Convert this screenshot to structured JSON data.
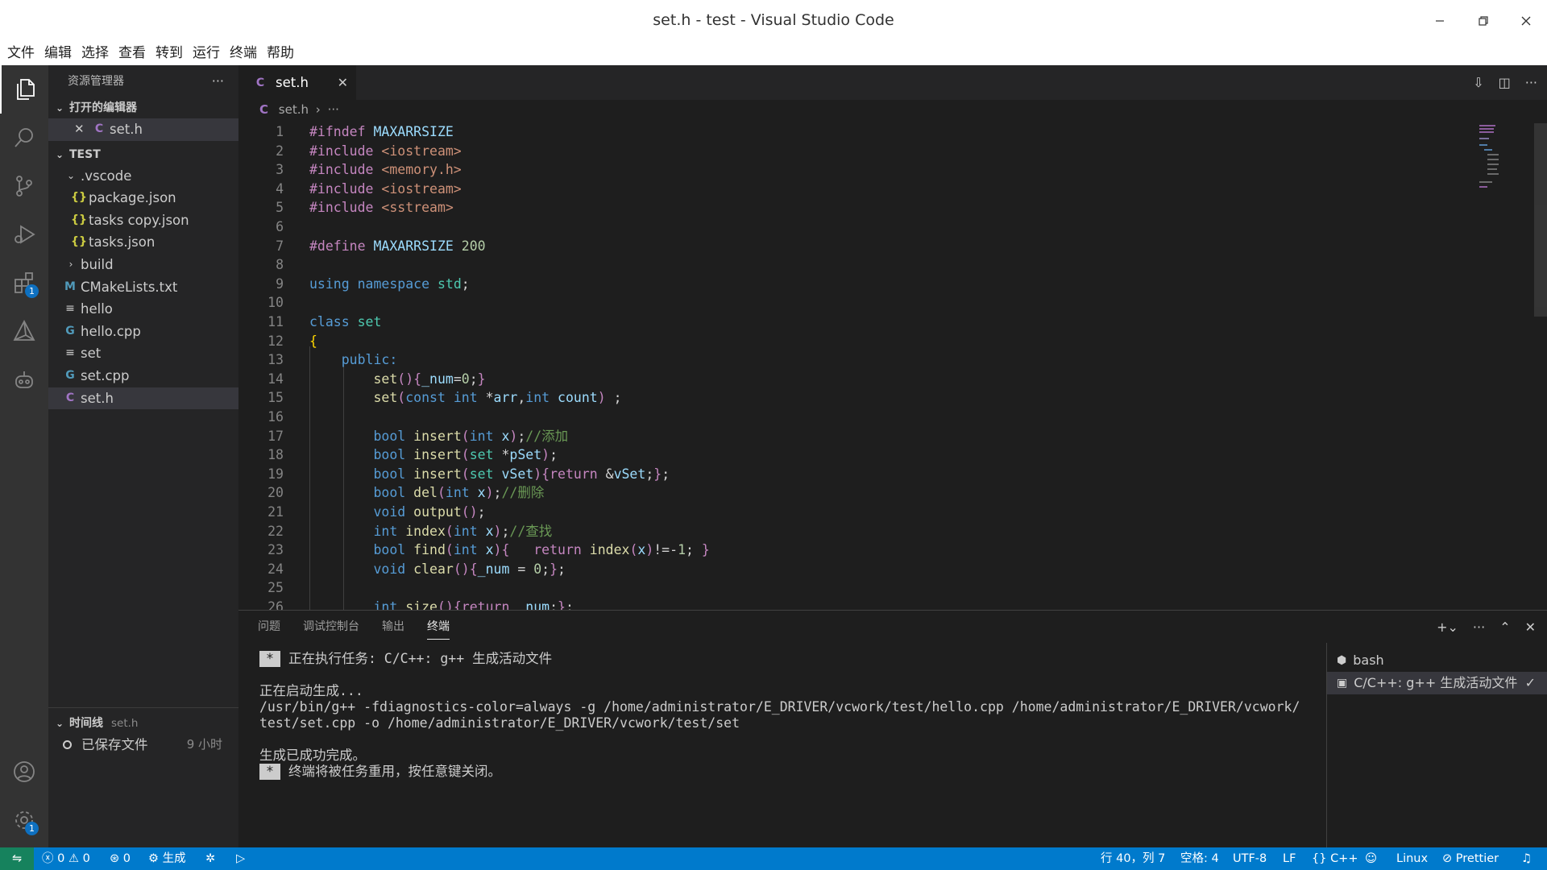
{
  "window": {
    "title": "set.h - test - Visual Studio Code"
  },
  "menu": [
    "文件",
    "编辑",
    "选择",
    "查看",
    "转到",
    "运行",
    "终端",
    "帮助"
  ],
  "sidebar": {
    "title": "资源管理器",
    "open_editors": {
      "label": "打开的编辑器",
      "items": [
        {
          "name": "set.h",
          "icon": "c-icon"
        }
      ]
    },
    "project": {
      "label": "TEST",
      "items": [
        {
          "name": ".vscode",
          "type": "folder-open",
          "indent": 1
        },
        {
          "name": "package.json",
          "type": "json",
          "indent": 2
        },
        {
          "name": "tasks copy.json",
          "type": "json",
          "indent": 2
        },
        {
          "name": "tasks.json",
          "type": "json",
          "indent": 2
        },
        {
          "name": "build",
          "type": "folder",
          "indent": 1
        },
        {
          "name": "CMakeLists.txt",
          "type": "cmake",
          "indent": 1
        },
        {
          "name": "hello",
          "type": "text",
          "indent": 1
        },
        {
          "name": "hello.cpp",
          "type": "cpp",
          "indent": 1
        },
        {
          "name": "set",
          "type": "text",
          "indent": 1
        },
        {
          "name": "set.cpp",
          "type": "cpp",
          "indent": 1
        },
        {
          "name": "set.h",
          "type": "c",
          "indent": 1,
          "selected": true
        }
      ]
    },
    "timeline": {
      "label": "时间线",
      "file": "set.h",
      "entry": "已保存文件",
      "time": "9 小时"
    }
  },
  "activity": {
    "extensions_badge": "1",
    "settings_badge": "1"
  },
  "editor": {
    "tab": {
      "label": "set.h",
      "icon": "C"
    },
    "breadcrumb": {
      "file": "set.h",
      "more": "···"
    },
    "code_lines": [
      [
        [
          "p",
          "#ifndef "
        ],
        [
          "v",
          "MAXARRSIZE"
        ]
      ],
      [
        [
          "p",
          "#include "
        ],
        [
          "s",
          "<iostream>"
        ]
      ],
      [
        [
          "p",
          "#include "
        ],
        [
          "s",
          "<memory.h>"
        ]
      ],
      [
        [
          "p",
          "#include "
        ],
        [
          "s",
          "<iostream>"
        ]
      ],
      [
        [
          "p",
          "#include "
        ],
        [
          "s",
          "<sstream>"
        ]
      ],
      [],
      [
        [
          "p",
          "#define "
        ],
        [
          "v",
          "MAXARRSIZE "
        ],
        [
          "n",
          "200"
        ]
      ],
      [],
      [
        [
          "k",
          "using "
        ],
        [
          "k",
          "namespace "
        ],
        [
          "t",
          "std"
        ],
        [
          "m",
          ";"
        ]
      ],
      [],
      [
        [
          "k",
          "class "
        ],
        [
          "t",
          "set"
        ]
      ],
      [
        [
          "y",
          "{"
        ]
      ],
      [
        [
          "m",
          "    "
        ],
        [
          "k",
          "public:"
        ]
      ],
      [
        [
          "m",
          "        "
        ],
        [
          "f",
          "set"
        ],
        [
          "p",
          "()"
        ],
        [
          "p",
          "{"
        ],
        [
          "v",
          "_num"
        ],
        [
          "m",
          "="
        ],
        [
          "n",
          "0"
        ],
        [
          "m",
          ";"
        ],
        [
          "p",
          "}"
        ]
      ],
      [
        [
          "m",
          "        "
        ],
        [
          "f",
          "set"
        ],
        [
          "p",
          "("
        ],
        [
          "k",
          "const "
        ],
        [
          "k",
          "int "
        ],
        [
          "m",
          "*"
        ],
        [
          "v",
          "arr"
        ],
        [
          "m",
          ","
        ],
        [
          "k",
          "int "
        ],
        [
          "v",
          "count"
        ],
        [
          "p",
          ")"
        ],
        [
          "m",
          " ;"
        ]
      ],
      [],
      [
        [
          "m",
          "        "
        ],
        [
          "k",
          "bool "
        ],
        [
          "f",
          "insert"
        ],
        [
          "p",
          "("
        ],
        [
          "k",
          "int "
        ],
        [
          "v",
          "x"
        ],
        [
          "p",
          ")"
        ],
        [
          "m",
          ";"
        ],
        [
          "c",
          "//添加"
        ]
      ],
      [
        [
          "m",
          "        "
        ],
        [
          "k",
          "bool "
        ],
        [
          "f",
          "insert"
        ],
        [
          "p",
          "("
        ],
        [
          "t",
          "set "
        ],
        [
          "m",
          "*"
        ],
        [
          "v",
          "pSet"
        ],
        [
          "p",
          ")"
        ],
        [
          "m",
          ";"
        ]
      ],
      [
        [
          "m",
          "        "
        ],
        [
          "k",
          "bool "
        ],
        [
          "f",
          "insert"
        ],
        [
          "p",
          "("
        ],
        [
          "t",
          "set "
        ],
        [
          "v",
          "vSet"
        ],
        [
          "p",
          ")"
        ],
        [
          "p",
          "{"
        ],
        [
          "p",
          "return "
        ],
        [
          "m",
          "&"
        ],
        [
          "v",
          "vSet"
        ],
        [
          "m",
          ";"
        ],
        [
          "p",
          "}"
        ],
        [
          "m",
          ";"
        ]
      ],
      [
        [
          "m",
          "        "
        ],
        [
          "k",
          "bool "
        ],
        [
          "f",
          "del"
        ],
        [
          "p",
          "("
        ],
        [
          "k",
          "int "
        ],
        [
          "v",
          "x"
        ],
        [
          "p",
          ")"
        ],
        [
          "m",
          ";"
        ],
        [
          "c",
          "//删除"
        ]
      ],
      [
        [
          "m",
          "        "
        ],
        [
          "k",
          "void "
        ],
        [
          "f",
          "output"
        ],
        [
          "p",
          "()"
        ],
        [
          "m",
          ";"
        ]
      ],
      [
        [
          "m",
          "        "
        ],
        [
          "k",
          "int "
        ],
        [
          "f",
          "index"
        ],
        [
          "p",
          "("
        ],
        [
          "k",
          "int "
        ],
        [
          "v",
          "x"
        ],
        [
          "p",
          ")"
        ],
        [
          "m",
          ";"
        ],
        [
          "c",
          "//查找"
        ]
      ],
      [
        [
          "m",
          "        "
        ],
        [
          "k",
          "bool "
        ],
        [
          "f",
          "find"
        ],
        [
          "p",
          "("
        ],
        [
          "k",
          "int "
        ],
        [
          "v",
          "x"
        ],
        [
          "p",
          ")"
        ],
        [
          "p",
          "{"
        ],
        [
          "m",
          "   "
        ],
        [
          "p",
          "return "
        ],
        [
          "f",
          "index"
        ],
        [
          "p",
          "("
        ],
        [
          "v",
          "x"
        ],
        [
          "p",
          ")"
        ],
        [
          "m",
          "!=-"
        ],
        [
          "n",
          "1"
        ],
        [
          "m",
          "; "
        ],
        [
          "p",
          "}"
        ]
      ],
      [
        [
          "m",
          "        "
        ],
        [
          "k",
          "void "
        ],
        [
          "f",
          "clear"
        ],
        [
          "p",
          "()"
        ],
        [
          "p",
          "{"
        ],
        [
          "v",
          "_num"
        ],
        [
          "m",
          " = "
        ],
        [
          "n",
          "0"
        ],
        [
          "m",
          ";"
        ],
        [
          "p",
          "}"
        ],
        [
          "m",
          ";"
        ]
      ],
      [],
      [
        [
          "m",
          "        "
        ],
        [
          "k",
          "int "
        ],
        [
          "f",
          "size"
        ],
        [
          "p",
          "()"
        ],
        [
          "p",
          "{"
        ],
        [
          "p",
          "return "
        ],
        [
          "v",
          "_num"
        ],
        [
          "m",
          ";"
        ],
        [
          "p",
          "}"
        ],
        [
          "m",
          ";"
        ]
      ]
    ]
  },
  "panel": {
    "tabs": [
      "问题",
      "调试控制台",
      "输出",
      "终端"
    ],
    "active_tab": "终端",
    "terminal": [
      {
        "star": true,
        "text": "正在执行任务: C/C++: g++ 生成活动文件"
      },
      {
        "text": ""
      },
      {
        "text": "正在启动生成..."
      },
      {
        "text": "/usr/bin/g++ -fdiagnostics-color=always -g /home/administrator/E_DRIVER/vcwork/test/hello.cpp /home/administrator/E_DRIVER/vcwork/"
      },
      {
        "text": "test/set.cpp -o /home/administrator/E_DRIVER/vcwork/test/set"
      },
      {
        "text": ""
      },
      {
        "text": "生成已成功完成。"
      },
      {
        "star": true,
        "text": "终端将被任务重用，按任意键关闭。"
      }
    ],
    "terminals": [
      {
        "name": "bash",
        "icon": "bash-icon"
      },
      {
        "name": "C/C++: g++ 生成活动文件",
        "icon": "terminal-icon",
        "selected": true,
        "check": "✓"
      }
    ]
  },
  "statusbar": {
    "errors": "0",
    "warnings": "0",
    "ports": "0",
    "build": "生成",
    "cursor": "行 40，列 7",
    "spaces": "空格: 4",
    "encoding": "UTF-8",
    "eol": "LF",
    "language": "C++",
    "platform": "Linux",
    "prettier": "Prettier",
    "colors": {
      "bar": "#007acc",
      "remote": "#16825d"
    }
  }
}
